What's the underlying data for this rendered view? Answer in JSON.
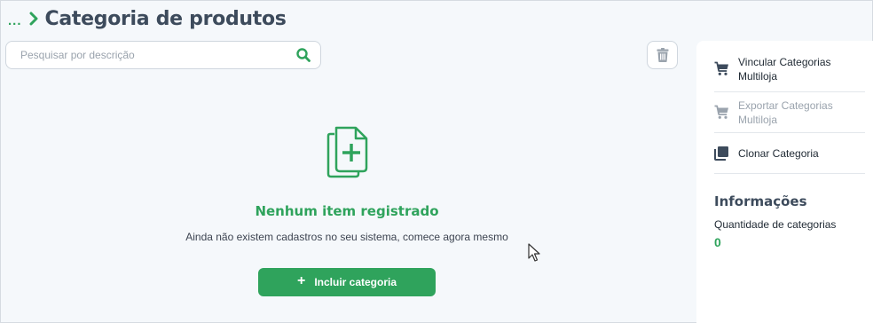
{
  "header": {
    "breadcrumb_dots": "...",
    "title": "Categoria de produtos"
  },
  "search": {
    "placeholder": "Pesquisar por descrição",
    "value": ""
  },
  "empty_state": {
    "title": "Nenhum item registrado",
    "description": "Ainda não existem cadastros no seu sistema, comece agora mesmo",
    "button_label": "Incluir categoria"
  },
  "sidebar": {
    "items": [
      {
        "label": "Vincular Categorias Multiloja",
        "icon": "cart-icon",
        "enabled": true
      },
      {
        "label": "Exportar Categorias Multiloja",
        "icon": "cart-icon",
        "enabled": false
      },
      {
        "label": "Clonar Categoria",
        "icon": "clone-icon",
        "enabled": true
      }
    ],
    "info_title": "Informações",
    "info_label": "Quantidade de categorias",
    "info_value": "0"
  },
  "colors": {
    "accent": "#2fa35c",
    "title": "#3d4b5c",
    "background": "#f5f8fb"
  }
}
